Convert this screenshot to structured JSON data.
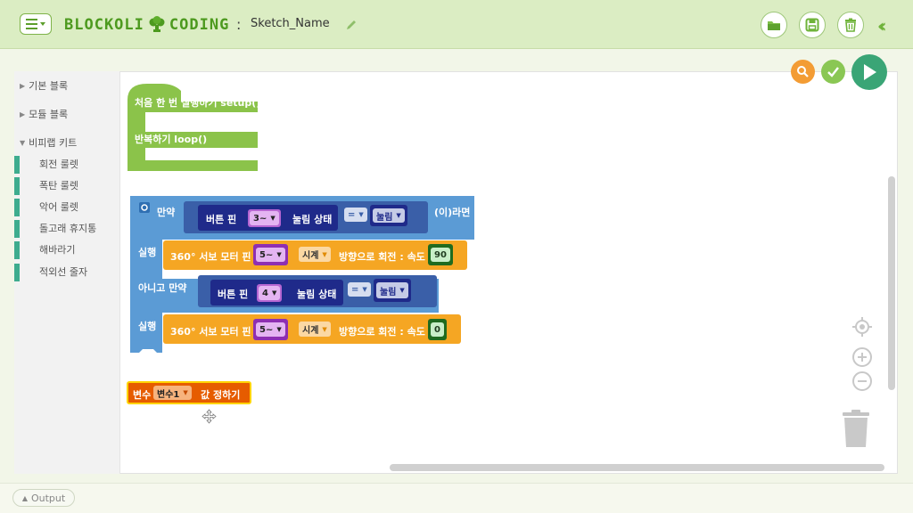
{
  "header": {
    "logo_text": "BLOCKOLI",
    "logo_text2": "CODING",
    "separator": ":",
    "sketch_name": "Sketch_Name"
  },
  "sidebar": {
    "categories": [
      {
        "label": "기본 블록"
      },
      {
        "label": "모듈 블록"
      },
      {
        "label": "비피랩 키트"
      }
    ],
    "kit_items": [
      "회전 룰렛",
      "폭탄 룰렛",
      "악어 룰렛",
      "돌고래 휴지통",
      "해바라기",
      "적외선 줄자"
    ]
  },
  "blocks": {
    "setup_label": "처음 한 번 실행하기 setup()",
    "loop_label": "반복하기 loop()",
    "if_label": "만약",
    "then_label": "(이)라면",
    "do_label": "실행",
    "elseif_label": "아니고 만약",
    "button_pin": "버튼 핀",
    "pin_val1": "3~",
    "pin_val2": "4",
    "pressed_state": "눌림 상태",
    "eq": "=",
    "pressed": "눌림",
    "servo_label": "360° 서보 모터 핀",
    "servo_pin": "5~",
    "direction": "시계",
    "rotate_label": "방향으로 회전 : 속도",
    "speed1": "90",
    "speed2": "0",
    "var_label": "변수",
    "var_name": "변수1",
    "set_label": "값 정하기"
  },
  "footer": {
    "output_label": "Output"
  },
  "colors": {
    "setup_green": "#8bc34a",
    "logic_blue": "#5b9bd5",
    "servo_orange": "#f5a623",
    "var_orange": "#e65c00",
    "button_navy": "#1f2a8a",
    "play_green": "#3aa576"
  }
}
